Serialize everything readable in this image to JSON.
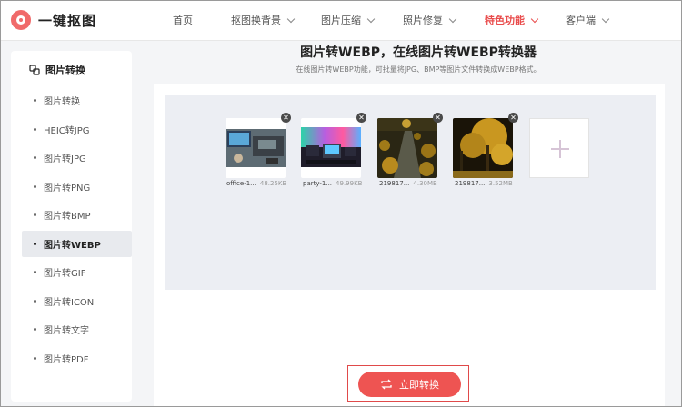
{
  "brand": {
    "name": "一键抠图"
  },
  "nav": [
    {
      "label": "首页",
      "has_dropdown": false
    },
    {
      "label": "抠图换背景",
      "has_dropdown": true
    },
    {
      "label": "图片压缩",
      "has_dropdown": true
    },
    {
      "label": "照片修复",
      "has_dropdown": true
    },
    {
      "label": "特色功能",
      "has_dropdown": true,
      "active": true
    },
    {
      "label": "客户端",
      "has_dropdown": true
    }
  ],
  "sidebar": {
    "title": "图片转换",
    "items": [
      {
        "label": "图片转换"
      },
      {
        "label": "HEIC转JPG"
      },
      {
        "label": "图片转JPG"
      },
      {
        "label": "图片转PNG"
      },
      {
        "label": "图片转BMP"
      },
      {
        "label": "图片转WEBP",
        "active": true
      },
      {
        "label": "图片转GIF"
      },
      {
        "label": "图片转ICON"
      },
      {
        "label": "图片转文字"
      },
      {
        "label": "图片转PDF"
      }
    ]
  },
  "main": {
    "title": "图片转WEBP，在线图片转WEBP转换器",
    "subtitle": "在线图片转WEBP功能，可批量将JPG、BMP等图片文件转换成WEBP格式。",
    "files": [
      {
        "name": "office-1...",
        "size": "48.25KB"
      },
      {
        "name": "party-1...",
        "size": "49.99KB"
      },
      {
        "name": "219817...",
        "size": "4.30MB"
      },
      {
        "name": "219817...",
        "size": "3.52MB"
      }
    ],
    "convert_button": "立即转换"
  },
  "colors": {
    "accent": "#ee5452",
    "active_nav": "#e94c4c",
    "dropzone": "#eceef3",
    "page_bg": "#f4f5f7"
  }
}
